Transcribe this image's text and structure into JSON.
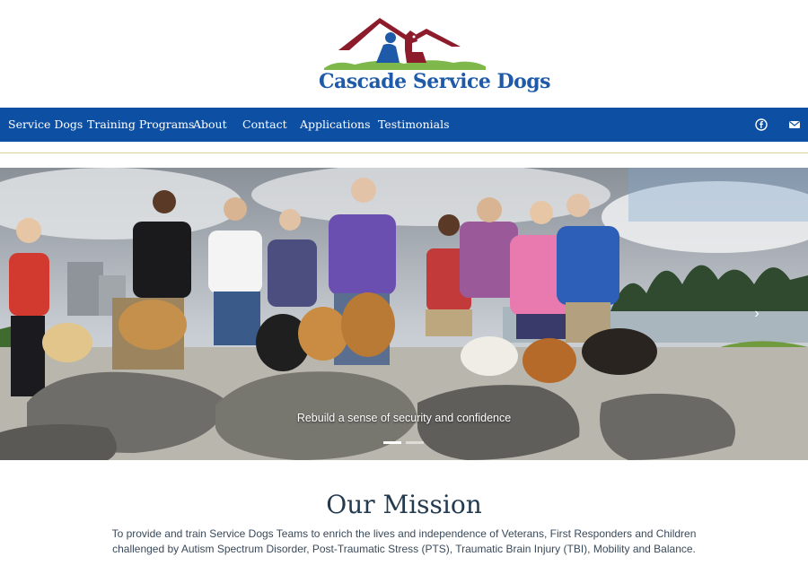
{
  "header": {
    "logo_text": "Cascade Service Dogs"
  },
  "nav": {
    "items": [
      "Service Dogs",
      "Training Programs",
      "About",
      "Contact",
      "Applications",
      "Testimonials"
    ],
    "icons": [
      "facebook-icon",
      "email-icon"
    ]
  },
  "hero": {
    "caption": "Rebuild a sense of security and confidence",
    "slides_total": 2,
    "active_slide": 1
  },
  "mission": {
    "title": "Our Mission",
    "text": "To provide and train Service Dogs Teams to enrich the lives and independence of Veterans, First Responders and Children challenged by Autism Spectrum Disorder, Post-Traumatic Stress (PTS), Traumatic Brain Injury (TBI), Mobility and Balance."
  },
  "colors": {
    "nav_bg": "#0d4fa3",
    "logo_blue": "#1e5aa8",
    "logo_maroon": "#8c1c2c",
    "title_color": "#243a4f"
  }
}
